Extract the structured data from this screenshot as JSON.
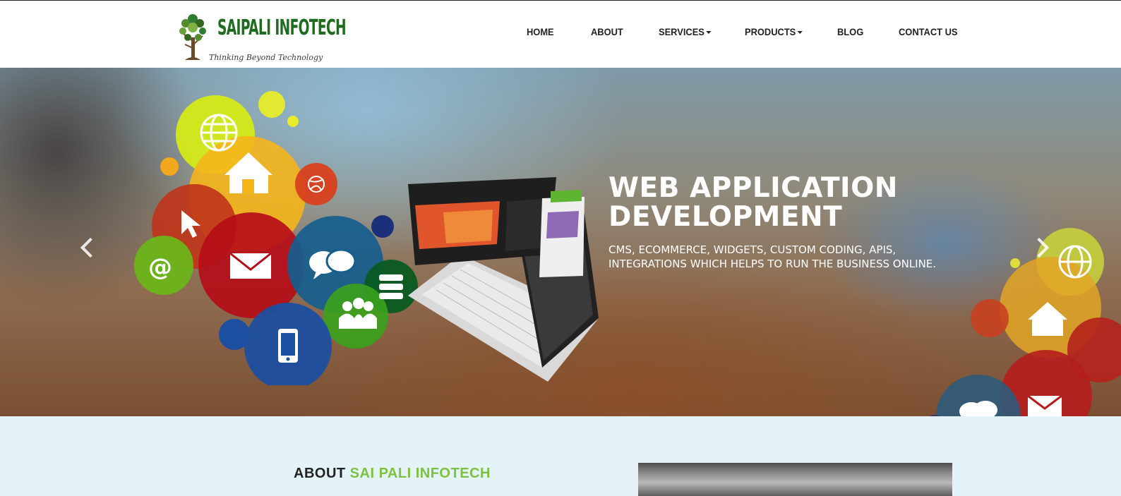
{
  "header": {
    "logo": {
      "name": "SAIPALI INFOTECH",
      "tagline": "Thinking Beyond Technology"
    },
    "nav": [
      {
        "label": "HOME",
        "dropdown": false
      },
      {
        "label": "ABOUT",
        "dropdown": false
      },
      {
        "label": "SERVICES",
        "dropdown": true
      },
      {
        "label": "PRODUCTS",
        "dropdown": true
      },
      {
        "label": "BLOG",
        "dropdown": false
      },
      {
        "label": "CONTACT US",
        "dropdown": false
      }
    ]
  },
  "hero": {
    "title_line1": "WEB APPLICATION",
    "title_line2": "DEVELOPMENT",
    "subtitle_line1": "CMS, ECOMMERCE, WIDGETS, CUSTOM CODING, APIS,",
    "subtitle_line2": "INTEGRATIONS WHICH HELPS TO RUN THE BUSINESS ONLINE.",
    "icons": [
      "globe-icon",
      "home-icon",
      "cursor-icon",
      "at-icon",
      "mail-icon",
      "chat-icon",
      "server-icon",
      "users-icon",
      "mobile-icon",
      "dribbble-icon",
      "laptop-icon"
    ]
  },
  "about": {
    "title_prefix": "ABOUT",
    "title_highlight": "SAI PALI INFOTECH"
  },
  "colors": {
    "brand_green": "#1f6b1f",
    "accent_green": "#7bc23f",
    "about_bg": "#e4f3f8"
  }
}
